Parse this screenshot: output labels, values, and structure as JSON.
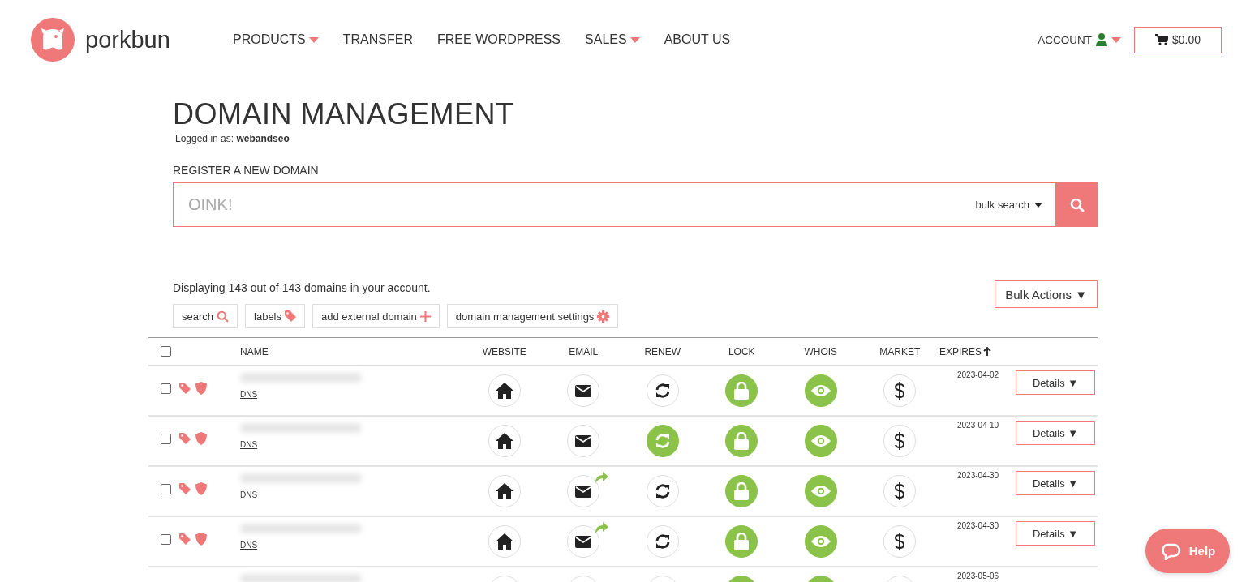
{
  "brand": {
    "name": "porkbun"
  },
  "nav": [
    {
      "label": "PRODUCTS",
      "dropdown": true
    },
    {
      "label": "TRANSFER",
      "dropdown": false
    },
    {
      "label": "FREE WORDPRESS",
      "dropdown": false
    },
    {
      "label": "SALES",
      "dropdown": true
    },
    {
      "label": "ABOUT US",
      "dropdown": false
    }
  ],
  "account": {
    "label": "ACCOUNT"
  },
  "cart": {
    "total": "$0.00"
  },
  "page": {
    "title": "DOMAIN MANAGEMENT",
    "logged_in_label": "Logged in as:",
    "username": "webandseo"
  },
  "register": {
    "heading": "REGISTER A NEW DOMAIN",
    "placeholder": "OINK!",
    "bulk_search": "bulk search"
  },
  "summary": "Displaying 143 out of 143 domains in your account.",
  "bulk_actions": "Bulk Actions ▼",
  "tools": [
    {
      "label": "search",
      "kind": "search"
    },
    {
      "label": "labels",
      "kind": "tag"
    },
    {
      "label": "add external domain",
      "kind": "plus"
    },
    {
      "label": "domain management settings",
      "kind": "gear"
    }
  ],
  "table": {
    "select_all_checked": false,
    "columns": [
      {
        "label": "NAME",
        "sorted": false
      },
      {
        "label": "WEBSITE",
        "sorted": false
      },
      {
        "label": "EMAIL",
        "sorted": false
      },
      {
        "label": "RENEW",
        "sorted": false
      },
      {
        "label": "LOCK",
        "sorted": false
      },
      {
        "label": "WHOIS",
        "sorted": false
      },
      {
        "label": "MARKET",
        "sorted": false
      },
      {
        "label": "EXPIRES",
        "sorted": true
      }
    ],
    "rows": [
      {
        "checked": false,
        "dns": "DNS",
        "email_forwarding": false,
        "auto_renew": false,
        "locked": true,
        "whois_privacy": true,
        "expires": "2023-04-02",
        "details": "Details ▼"
      },
      {
        "checked": false,
        "dns": "DNS",
        "email_forwarding": false,
        "auto_renew": true,
        "locked": true,
        "whois_privacy": true,
        "expires": "2023-04-10",
        "details": "Details ▼"
      },
      {
        "checked": false,
        "dns": "DNS",
        "email_forwarding": true,
        "auto_renew": false,
        "locked": true,
        "whois_privacy": true,
        "expires": "2023-04-30",
        "details": "Details ▼"
      },
      {
        "checked": false,
        "dns": "DNS",
        "email_forwarding": true,
        "auto_renew": false,
        "locked": true,
        "whois_privacy": true,
        "expires": "2023-04-30",
        "details": "Details ▼"
      },
      {
        "email_forwarding": false,
        "auto_renew": false,
        "locked": true,
        "whois_privacy": true,
        "expires": "2023-05-06"
      }
    ]
  },
  "help": {
    "label": "Help"
  }
}
